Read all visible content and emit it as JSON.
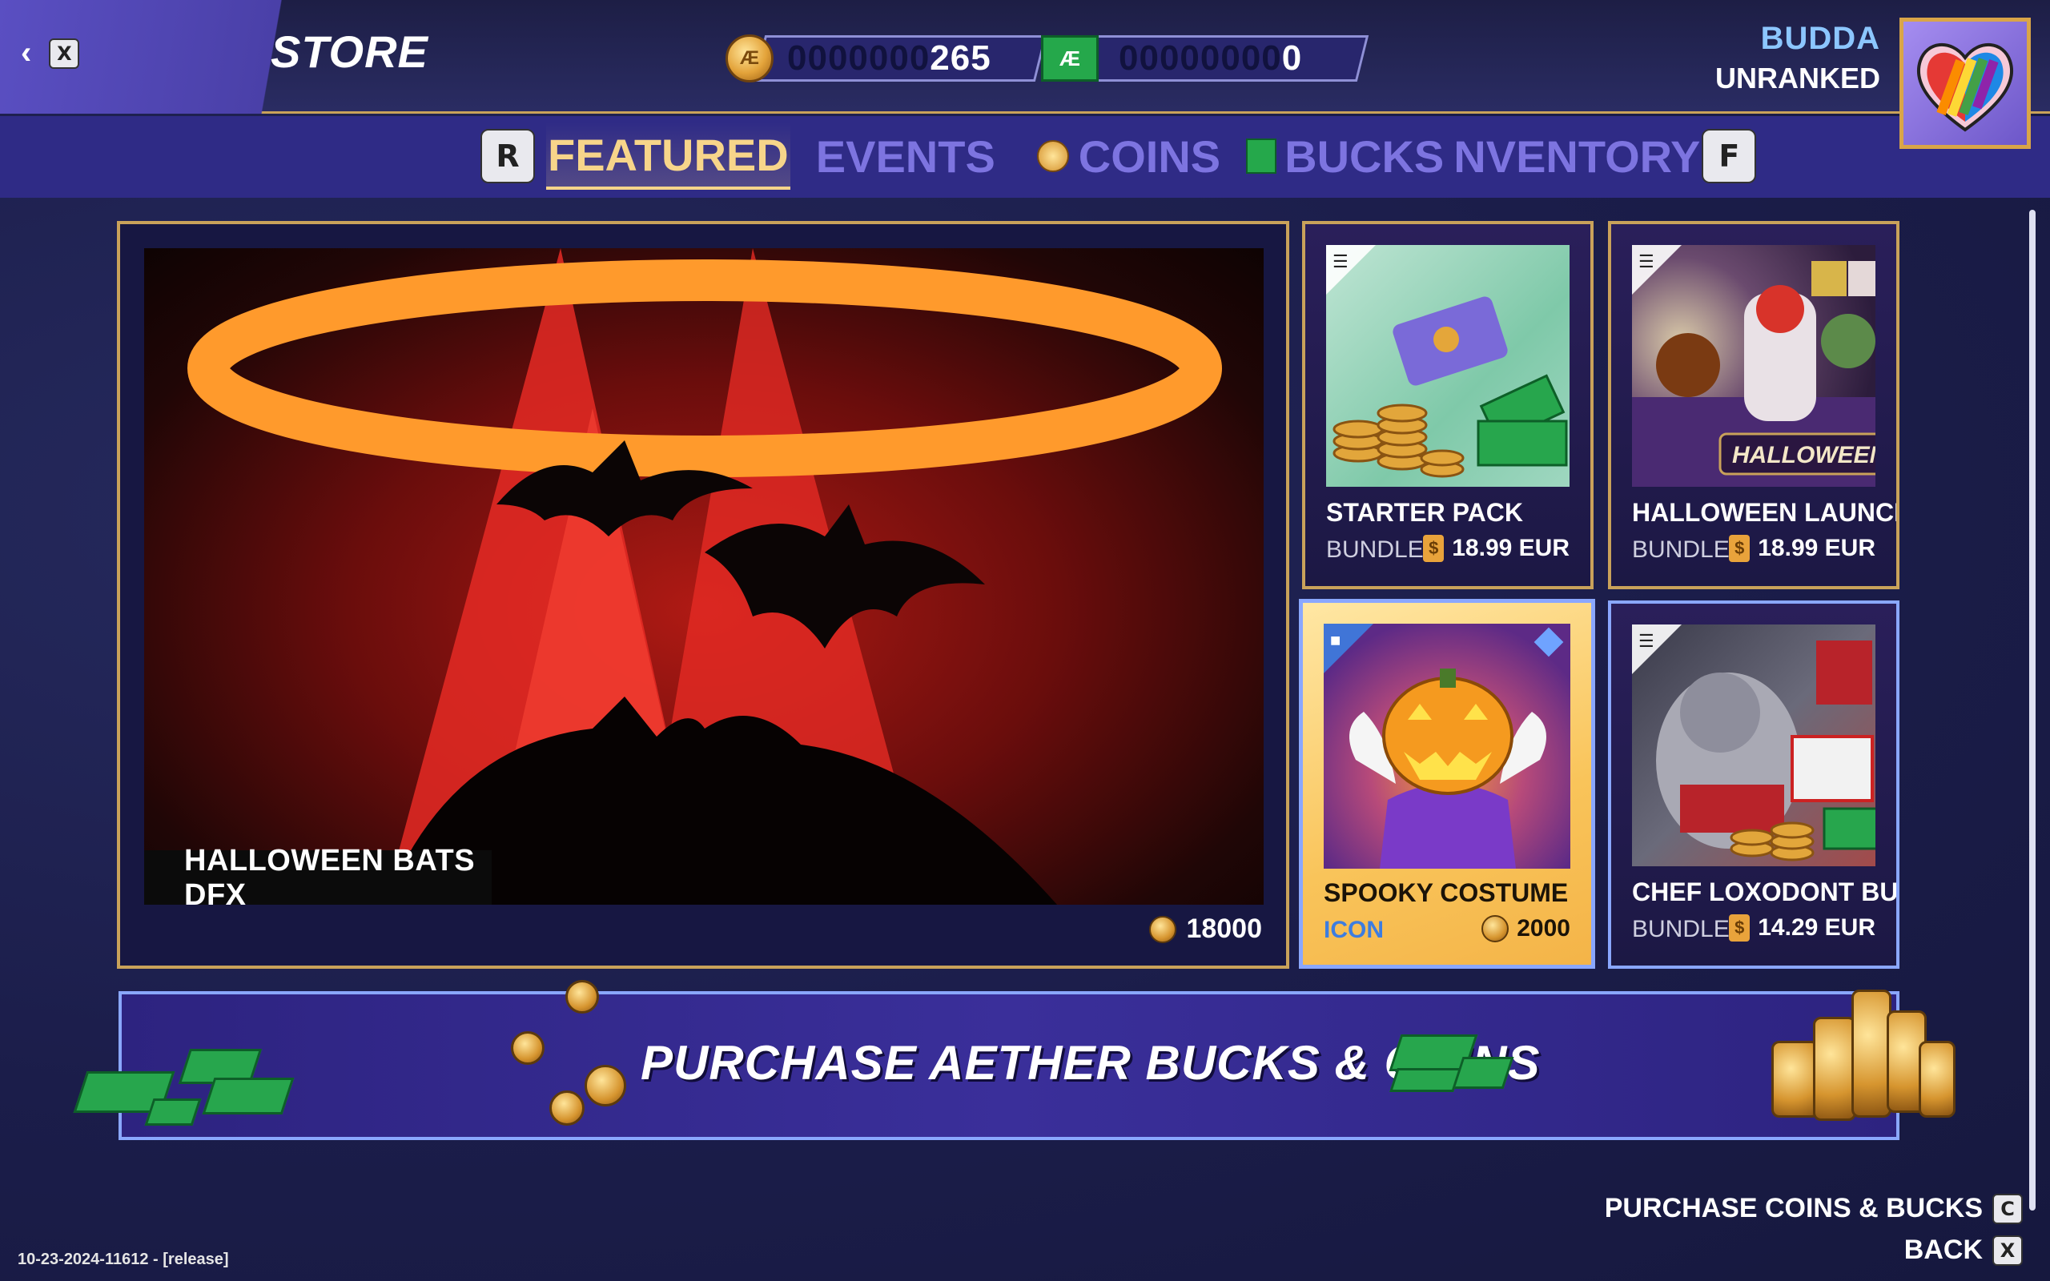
{
  "header": {
    "back_key": "X",
    "title": "STORE",
    "coins": {
      "dim": "0000000",
      "value": "265",
      "icon": "aether-coin-icon"
    },
    "bucks": {
      "dim": "00000000",
      "value": "0",
      "icon": "aether-bucks-icon"
    },
    "user": {
      "name": "BUDDA",
      "rank": "UNRANKED"
    }
  },
  "nav": {
    "prev_key": "R",
    "next_key": "F",
    "tabs": [
      {
        "label": "FEATURED",
        "active": true
      },
      {
        "label": "EVENTS"
      },
      {
        "label": "COINS",
        "icon": "coin-icon"
      },
      {
        "label": "BUCKS",
        "icon": "bucks-icon"
      },
      {
        "label": "NVENTORY"
      }
    ]
  },
  "featured": {
    "name": "HALLOWEEN BATS DFX",
    "price": "18000",
    "currency_icon": "aether-coin-icon"
  },
  "cards": [
    {
      "title": "STARTER PACK",
      "type": "BUNDLE",
      "price": "18.99 EUR"
    },
    {
      "title": "HALLOWEEN LAUNCH BUND",
      "type": "BUNDLE",
      "price": "18.99 EUR",
      "image_caption": "HALLOWEEN BU"
    },
    {
      "title": "SPOOKY COSTUME",
      "type": "ICON",
      "price": "2000"
    },
    {
      "title": "CHEF LOXODONT BUNDLE",
      "type": "BUNDLE",
      "price": "14.29 EUR"
    }
  ],
  "banner": {
    "text": "PURCHASE AETHER BUCKS & COINS"
  },
  "hints": [
    {
      "label": "PURCHASE COINS & BUCKS",
      "key": "C"
    },
    {
      "label": "BACK",
      "key": "X"
    }
  ],
  "version": "10-23-2024-11612 - [release]",
  "colors": {
    "gold": "#c9a25a",
    "active_tab": "#f7d58a",
    "inactive_tab": "#7d74e0",
    "username": "#8cc6ff",
    "icon_type": "#3d7de0"
  }
}
